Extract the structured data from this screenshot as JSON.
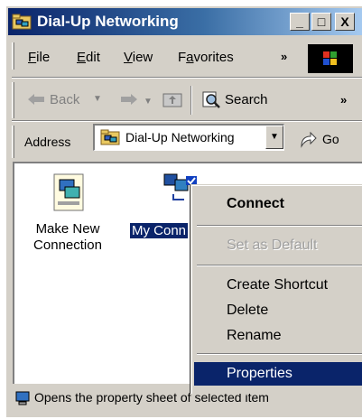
{
  "window": {
    "title": "Dial-Up Networking"
  },
  "title_buttons": {
    "minimize": "_",
    "maximize": "□",
    "close": "X"
  },
  "menu": {
    "items": [
      {
        "label": "File",
        "key": "F"
      },
      {
        "label": "Edit",
        "key": "E"
      },
      {
        "label": "View",
        "key": "V"
      },
      {
        "label": "Favorites",
        "key": "a"
      }
    ],
    "overflow": "»"
  },
  "toolbar": {
    "back": "Back",
    "search": "Search",
    "overflow": "»"
  },
  "address": {
    "label": "Address",
    "value": "Dial-Up Networking",
    "go": "Go"
  },
  "items": [
    {
      "label_line1": "Make New",
      "label_line2": "Connection"
    },
    {
      "label": "My Conn"
    }
  ],
  "context_menu": {
    "connect": "Connect",
    "set_default": "Set as Default",
    "create_shortcut": "Create Shortcut",
    "delete": "Delete",
    "rename": "Rename",
    "properties": "Properties"
  },
  "status": {
    "text": "Opens the property sheet of selected item"
  },
  "colors": {
    "title_start": "#0a246a",
    "title_end": "#a6caf0",
    "selection": "#0a246a",
    "face": "#d4d0c8"
  }
}
